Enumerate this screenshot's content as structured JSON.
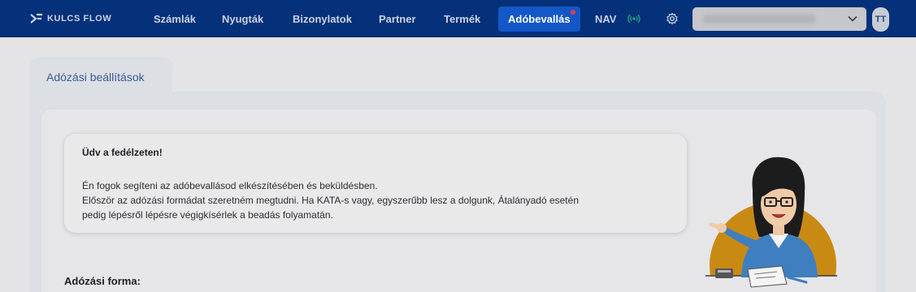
{
  "app": {
    "logo_text": "KULCS FLOW"
  },
  "nav": {
    "items": [
      {
        "label": "Számlák"
      },
      {
        "label": "Nyugták"
      },
      {
        "label": "Bizonylatok"
      },
      {
        "label": "Partner"
      },
      {
        "label": "Termék"
      },
      {
        "label": "Adóbevallás"
      },
      {
        "label": "NAV"
      }
    ],
    "active_index": 5
  },
  "user": {
    "initials": "TT"
  },
  "tabs": [
    {
      "label": "Adózási beállítások"
    }
  ],
  "welcome": {
    "title": "Üdv a fedélzeten!",
    "lines": [
      "Én fogok segíteni az adóbevallásod elkészítésében és beküldésben.",
      "Először az adózási formádat szeretném megtudni. Ha KATA-s vagy, egyszerűbb lesz a dolgunk, Átalányadó esetén",
      "pedig lépésről lépésre végigkísérlek a beadás folyamatán."
    ]
  },
  "form": {
    "section_label": "Adózási forma:"
  },
  "colors": {
    "nav_bg": "#05307a",
    "nav_active": "#1457c7",
    "notification_dot": "#e23b4d",
    "nav_status_icon": "#1fa37c",
    "mascot_circle": "#c98a14"
  },
  "icons": {
    "nav_status": "broadcast-signal-icon",
    "settings": "gear-icon",
    "select": "chevron-down-icon"
  }
}
